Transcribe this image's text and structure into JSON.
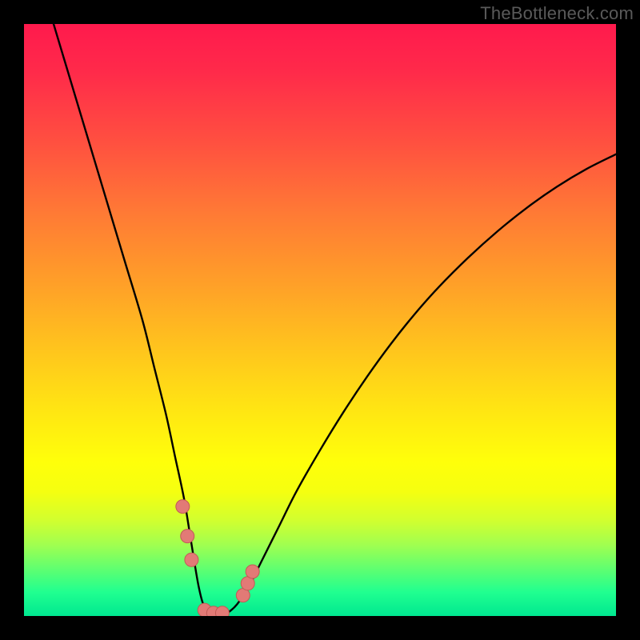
{
  "watermark": "TheBottleneck.com",
  "colors": {
    "background": "#000000",
    "curve_stroke": "#000000",
    "marker_fill": "#e27a76",
    "marker_stroke": "#c25b56"
  },
  "chart_data": {
    "type": "line",
    "title": "",
    "xlabel": "",
    "ylabel": "",
    "xlim": [
      0,
      100
    ],
    "ylim": [
      0,
      100
    ],
    "grid": false,
    "legend": false,
    "series": [
      {
        "name": "bottleneck-curve",
        "x": [
          5,
          8,
          11,
          14,
          17,
          20,
          22,
          24,
          25.5,
          27,
          28,
          28.8,
          29.5,
          30.2,
          31,
          32,
          33.2,
          34.5,
          36,
          38,
          40,
          43,
          46,
          50,
          54,
          58,
          62,
          66,
          70,
          75,
          80,
          85,
          90,
          95,
          100
        ],
        "y": [
          100,
          90,
          80,
          70,
          60,
          50,
          42,
          34,
          27,
          20,
          14,
          9,
          5,
          2.2,
          0.7,
          0,
          0,
          0.6,
          2,
          5,
          9,
          15,
          21,
          28,
          34.5,
          40.5,
          46,
          51,
          55.5,
          60.5,
          65,
          69,
          72.5,
          75.5,
          78
        ]
      }
    ],
    "markers": [
      {
        "x": 26.8,
        "y": 18.5
      },
      {
        "x": 27.6,
        "y": 13.5
      },
      {
        "x": 28.3,
        "y": 9.5
      },
      {
        "x": 30.5,
        "y": 1.0
      },
      {
        "x": 32.0,
        "y": 0.5
      },
      {
        "x": 33.5,
        "y": 0.5
      },
      {
        "x": 37.0,
        "y": 3.5
      },
      {
        "x": 37.8,
        "y": 5.5
      },
      {
        "x": 38.6,
        "y": 7.5
      }
    ]
  }
}
